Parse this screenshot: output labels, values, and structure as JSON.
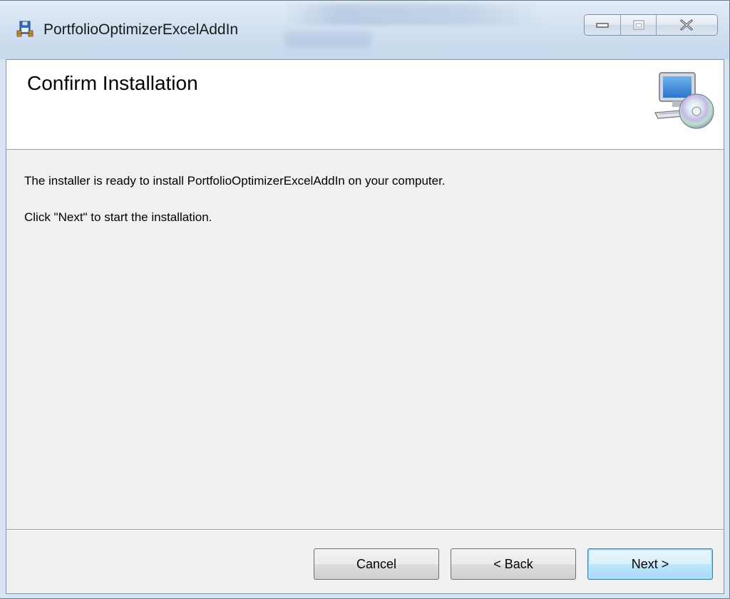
{
  "window": {
    "title": "PortfolioOptimizerExcelAddIn",
    "controls": [
      "minimize-icon",
      "maximize-icon",
      "close-icon"
    ]
  },
  "banner": {
    "title": "Confirm Installation",
    "icon": "computer-cd-icon"
  },
  "body": {
    "line1": "The installer is ready to install PortfolioOptimizerExcelAddIn on your computer.",
    "line2": "Click \"Next\" to start the installation."
  },
  "buttons": {
    "cancel_label": "Cancel",
    "back_label": "< Back",
    "next_label": "Next >"
  },
  "colors": {
    "dialog_background": "#f0f0f0",
    "banner_background": "#ffffff",
    "default_button_border": "#3c7fb1"
  }
}
